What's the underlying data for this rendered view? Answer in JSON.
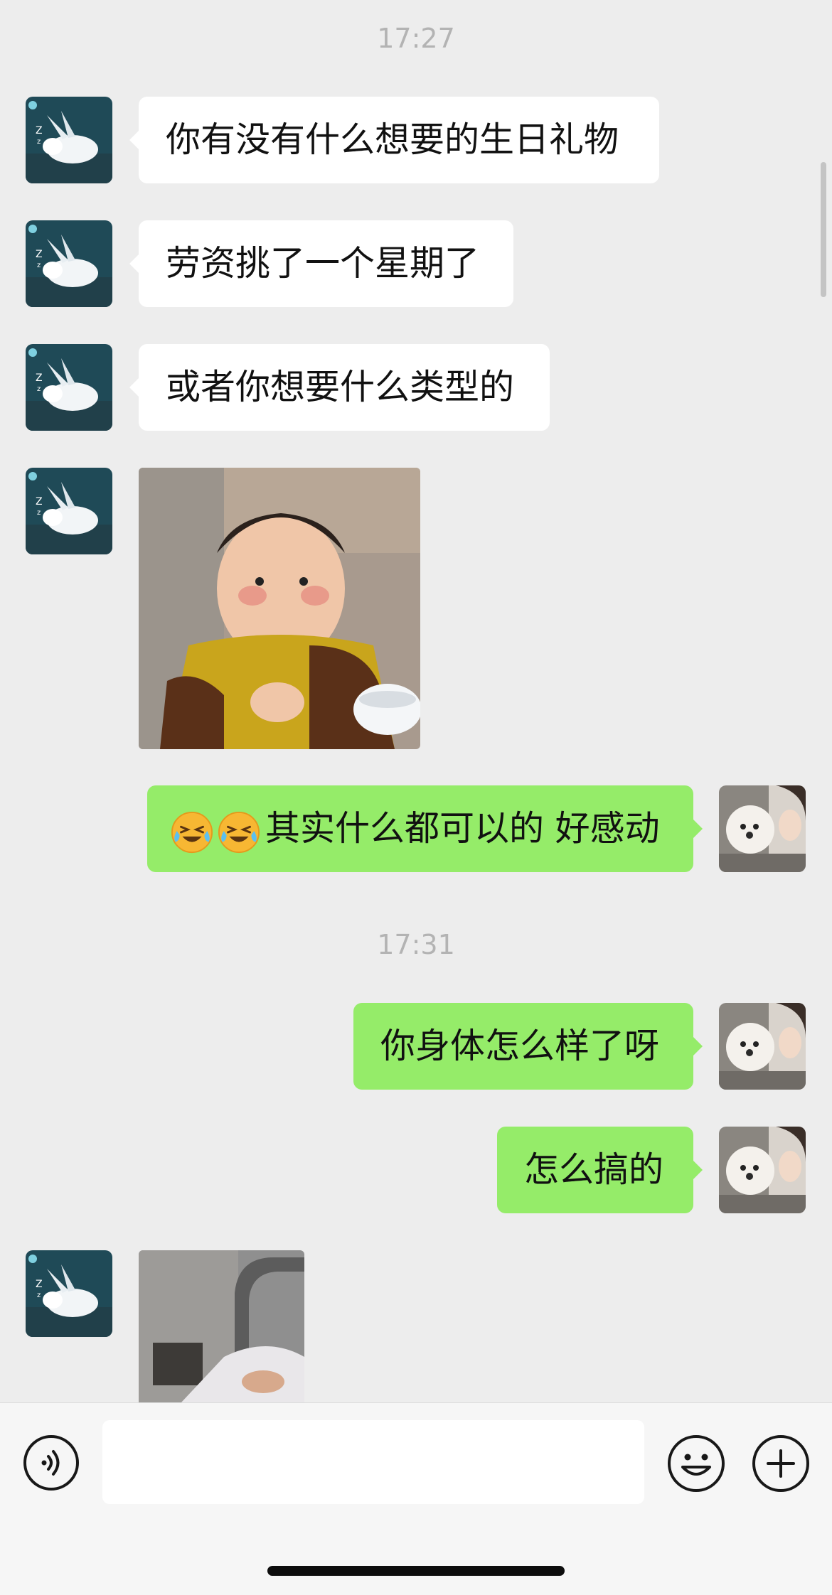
{
  "chat": {
    "timestamps": [
      "17:27",
      "17:31"
    ],
    "messages": [
      {
        "side": "in",
        "type": "text",
        "text": "你有没有什么想要的生日礼物"
      },
      {
        "side": "in",
        "type": "text",
        "text": "劳资挑了一个星期了"
      },
      {
        "side": "in",
        "type": "text",
        "text": "或者你想要什么类型的"
      },
      {
        "side": "in",
        "type": "image",
        "content": "baby eating sticker"
      },
      {
        "side": "out",
        "type": "text",
        "emoji": [
          "grinning-squinting-tears-emoji",
          "grinning-squinting-tears-emoji"
        ],
        "text": "其实什么都可以的 好感动"
      },
      {
        "side": "out",
        "type": "text",
        "text": "你身体怎么样了呀"
      },
      {
        "side": "out",
        "type": "text",
        "text": "怎么搞的"
      },
      {
        "side": "in",
        "type": "image",
        "content": "photo (partially visible)"
      }
    ]
  },
  "contacts": {
    "other_avatar": "sleeping-rabbit-avatar",
    "self_avatar": "white-dog-selfie-avatar"
  },
  "input_bar": {
    "text_value": "",
    "icons": [
      "voice-icon",
      "emoji-icon",
      "plus-icon"
    ]
  },
  "colors": {
    "background": "#ededed",
    "incoming_bubble": "#ffffff",
    "outgoing_bubble": "#95ec69",
    "timestamp_text": "#b3b3b3"
  }
}
